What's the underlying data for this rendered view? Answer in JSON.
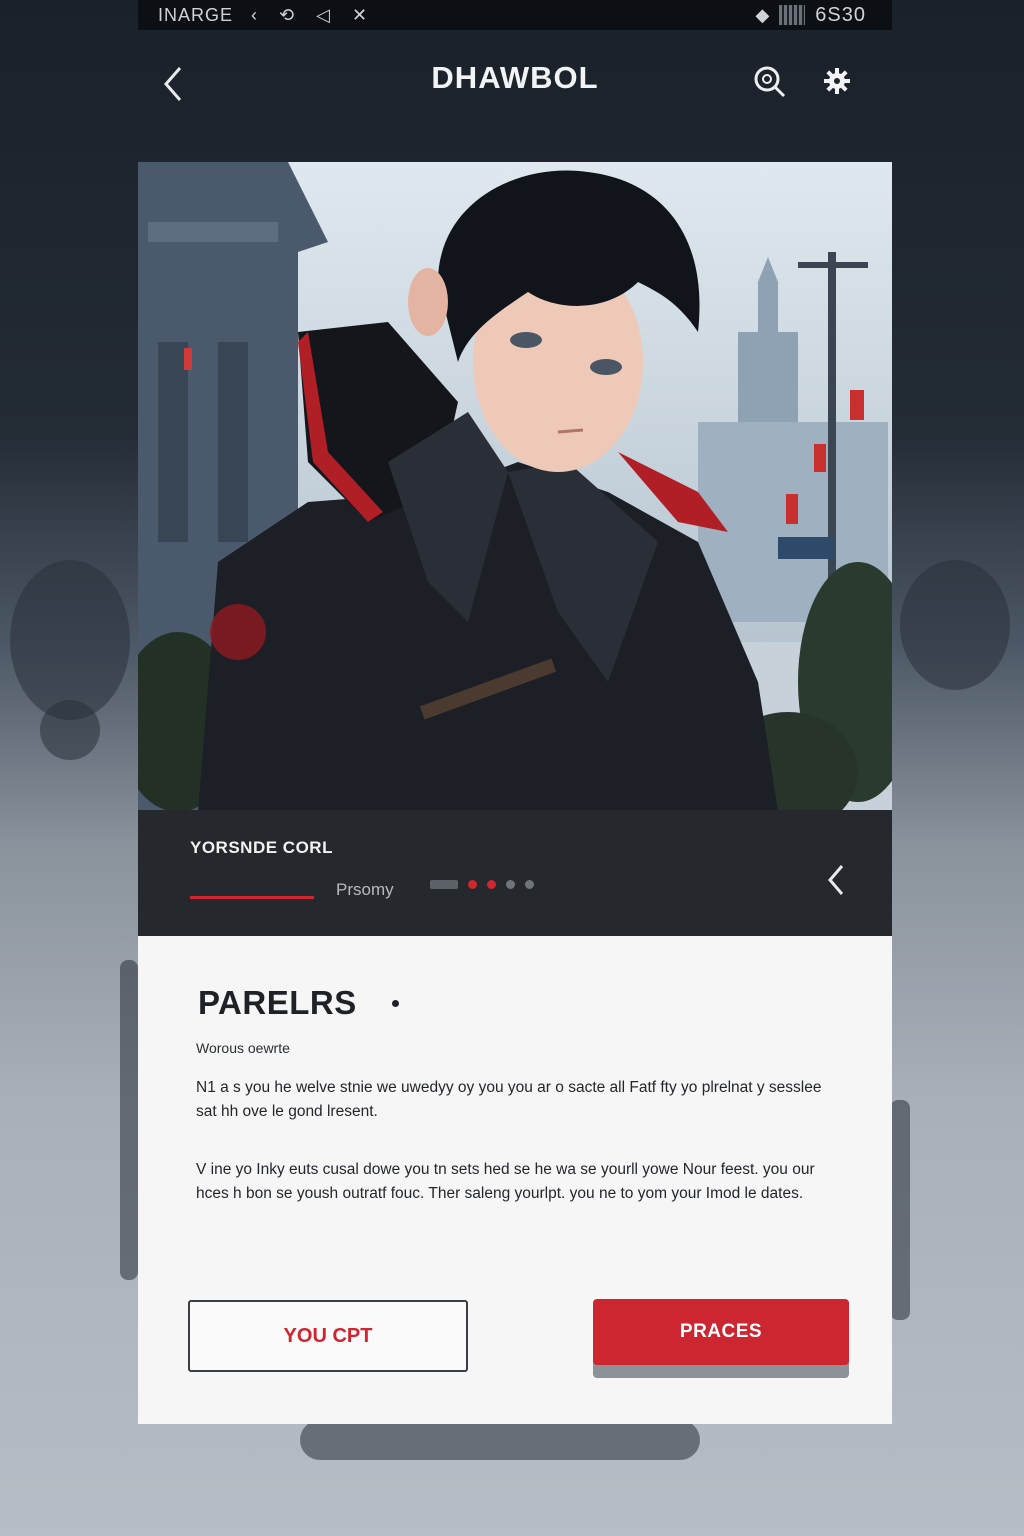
{
  "statusbar": {
    "app_label": "INARGE",
    "time": "6S30"
  },
  "header": {
    "title": "DHAWBOL"
  },
  "character": {
    "name": "YORSNDE CORL",
    "tab_secondary": "Prsomy"
  },
  "card": {
    "title": "PARELRS",
    "subtitle": "Worous oewrte",
    "paragraph_1": "N1 a s you he welve stnie we uwedyy oy you you ar o sacte all Fatf fty yo plrelnat y sesslee sat hh ove le gond lresent.",
    "paragraph_2": "V ine yo Inky euts cusal dowe you tn sets hed se he wa se yourll yowe Nour feest. you our hces h bon se yoush outratf fouc. Ther saleng yourlpt. you ne to yom your Imod le dates."
  },
  "buttons": {
    "secondary": "YOU CPT",
    "primary": "PRACES"
  },
  "colors": {
    "accent": "#cc2630",
    "dark_panel": "#25282d",
    "card_bg": "#f6f6f6"
  }
}
